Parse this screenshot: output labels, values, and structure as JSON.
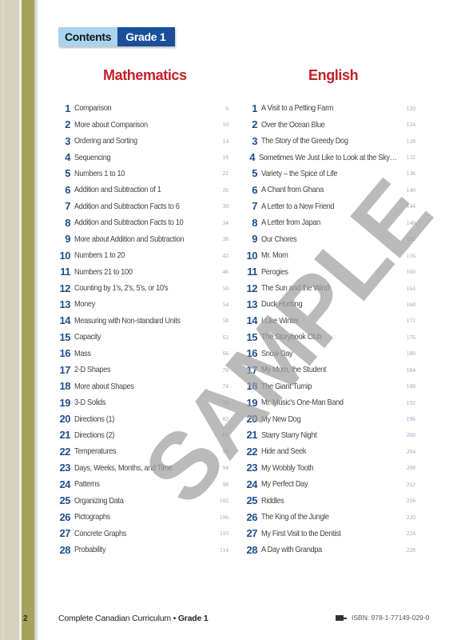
{
  "header": {
    "contents_label": "Contents",
    "grade_label": "Grade 1"
  },
  "colors": {
    "accent_red": "#c4202a",
    "accent_blue": "#1a4f9a",
    "light_blue": "#a9d4ee",
    "olive": "#a8a15a"
  },
  "watermark": "SAMPLE",
  "mathematics": {
    "title": "Mathematics",
    "items": [
      {
        "num": "1",
        "title": "Comparison",
        "page": "6"
      },
      {
        "num": "2",
        "title": "More about Comparison",
        "page": "10"
      },
      {
        "num": "3",
        "title": "Ordering and Sorting",
        "page": "14"
      },
      {
        "num": "4",
        "title": "Sequencing",
        "page": "18"
      },
      {
        "num": "5",
        "title": "Numbers 1 to 10",
        "page": "22"
      },
      {
        "num": "6",
        "title": "Addition and Subtraction of 1",
        "page": "26"
      },
      {
        "num": "7",
        "title": "Addition and Subtraction Facts to 6",
        "page": "30"
      },
      {
        "num": "8",
        "title": "Addition and Subtraction Facts to 10",
        "page": "34"
      },
      {
        "num": "9",
        "title": "More about Addition and Subtraction",
        "page": "38"
      },
      {
        "num": "10",
        "title": "Numbers 1 to 20",
        "page": "42"
      },
      {
        "num": "11",
        "title": "Numbers 21 to 100",
        "page": "46"
      },
      {
        "num": "12",
        "title": "Counting by 1's, 2's, 5's, or 10's",
        "page": "50"
      },
      {
        "num": "13",
        "title": "Money",
        "page": "54"
      },
      {
        "num": "14",
        "title": "Measuring with Non-standard Units",
        "page": "58"
      },
      {
        "num": "15",
        "title": "Capacity",
        "page": "62"
      },
      {
        "num": "16",
        "title": "Mass",
        "page": "66"
      },
      {
        "num": "17",
        "title": "2-D Shapes",
        "page": "70"
      },
      {
        "num": "18",
        "title": "More about Shapes",
        "page": "74"
      },
      {
        "num": "19",
        "title": "3-D Solids",
        "page": "78"
      },
      {
        "num": "20",
        "title": "Directions (1)",
        "page": "82"
      },
      {
        "num": "21",
        "title": "Directions (2)",
        "page": "86"
      },
      {
        "num": "22",
        "title": "Temperatures",
        "page": "90"
      },
      {
        "num": "23",
        "title": "Days, Weeks, Months, and Time",
        "page": "94"
      },
      {
        "num": "24",
        "title": "Patterns",
        "page": "98"
      },
      {
        "num": "25",
        "title": "Organizing Data",
        "page": "102"
      },
      {
        "num": "26",
        "title": "Pictographs",
        "page": "106"
      },
      {
        "num": "27",
        "title": "Concrete Graphs",
        "page": "110"
      },
      {
        "num": "28",
        "title": "Probability",
        "page": "114"
      }
    ]
  },
  "english": {
    "title": "English",
    "items": [
      {
        "num": "1",
        "title": "A Visit to a Petting Farm",
        "page": "120"
      },
      {
        "num": "2",
        "title": "Over the Ocean Blue",
        "page": "124"
      },
      {
        "num": "3",
        "title": "The Story of the Greedy Dog",
        "page": "128"
      },
      {
        "num": "4",
        "title": "Sometimes We Just Like to Look at the Sky…",
        "page": "132"
      },
      {
        "num": "5",
        "title": "Variety – the Spice of Life",
        "page": "136"
      },
      {
        "num": "6",
        "title": "A Chant from Ghana",
        "page": "140"
      },
      {
        "num": "7",
        "title": "A Letter to a New Friend",
        "page": "144"
      },
      {
        "num": "8",
        "title": "A Letter from Japan",
        "page": "148"
      },
      {
        "num": "9",
        "title": "Our Chores",
        "page": "152"
      },
      {
        "num": "10",
        "title": "Mr. Mom",
        "page": "156"
      },
      {
        "num": "11",
        "title": "Perogies",
        "page": "160"
      },
      {
        "num": "12",
        "title": "The Sun and the Wind",
        "page": "164"
      },
      {
        "num": "13",
        "title": "Duck Hunting",
        "page": "168"
      },
      {
        "num": "14",
        "title": "I Like Winter",
        "page": "172"
      },
      {
        "num": "15",
        "title": "The Storybook Club",
        "page": "176"
      },
      {
        "num": "16",
        "title": "Snow Day",
        "page": "180"
      },
      {
        "num": "17",
        "title": "My Mom, the Student",
        "page": "184"
      },
      {
        "num": "18",
        "title": "The Giant Turnip",
        "page": "188"
      },
      {
        "num": "19",
        "title": "Mr. Music's One-Man Band",
        "page": "192"
      },
      {
        "num": "20",
        "title": "My New Dog",
        "page": "196"
      },
      {
        "num": "21",
        "title": "Starry Starry Night",
        "page": "200"
      },
      {
        "num": "22",
        "title": "Hide and Seek",
        "page": "204"
      },
      {
        "num": "23",
        "title": "My Wobbly Tooth",
        "page": "208"
      },
      {
        "num": "24",
        "title": "My Perfect Day",
        "page": "212"
      },
      {
        "num": "25",
        "title": "Riddles",
        "page": "216"
      },
      {
        "num": "26",
        "title": "The King of the Jungle",
        "page": "220"
      },
      {
        "num": "27",
        "title": "My First Visit to the Dentist",
        "page": "224"
      },
      {
        "num": "28",
        "title": "A Day with Grandpa",
        "page": "228"
      }
    ]
  },
  "footer": {
    "page_number": "2",
    "book_title": "Complete Canadian Curriculum",
    "separator": " • ",
    "grade": "Grade 1",
    "isbn_icon": "publisher-logo-icon",
    "isbn": "ISBN: 978-1-77149-029-0"
  }
}
